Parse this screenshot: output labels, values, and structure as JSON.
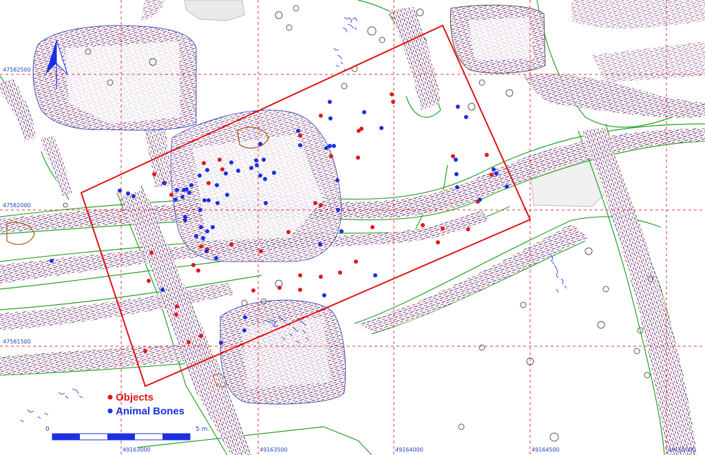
{
  "legend": {
    "objects_label": "Objects",
    "animal_bones_label": "Animal Bones",
    "objects_color": "#e01818",
    "bones_color": "#1a2fe0"
  },
  "grid": {
    "x_labels": [
      "49163000",
      "49163500",
      "49164000",
      "49164500",
      "49165000"
    ],
    "y_labels": [
      "47582500",
      "47582000",
      "47581500"
    ]
  },
  "scale_bar": {
    "start_label": "0",
    "end_label": "5 m."
  },
  "colors": {
    "trench_outline": "#22a022",
    "grid": "#d11111",
    "excavation_box": "#e01010",
    "contour_red": "#c0142d",
    "contour_blue": "#15148a",
    "north_arrow": "#1d2fe0"
  },
  "icons": {
    "north_arrow": "north-arrow-icon"
  }
}
